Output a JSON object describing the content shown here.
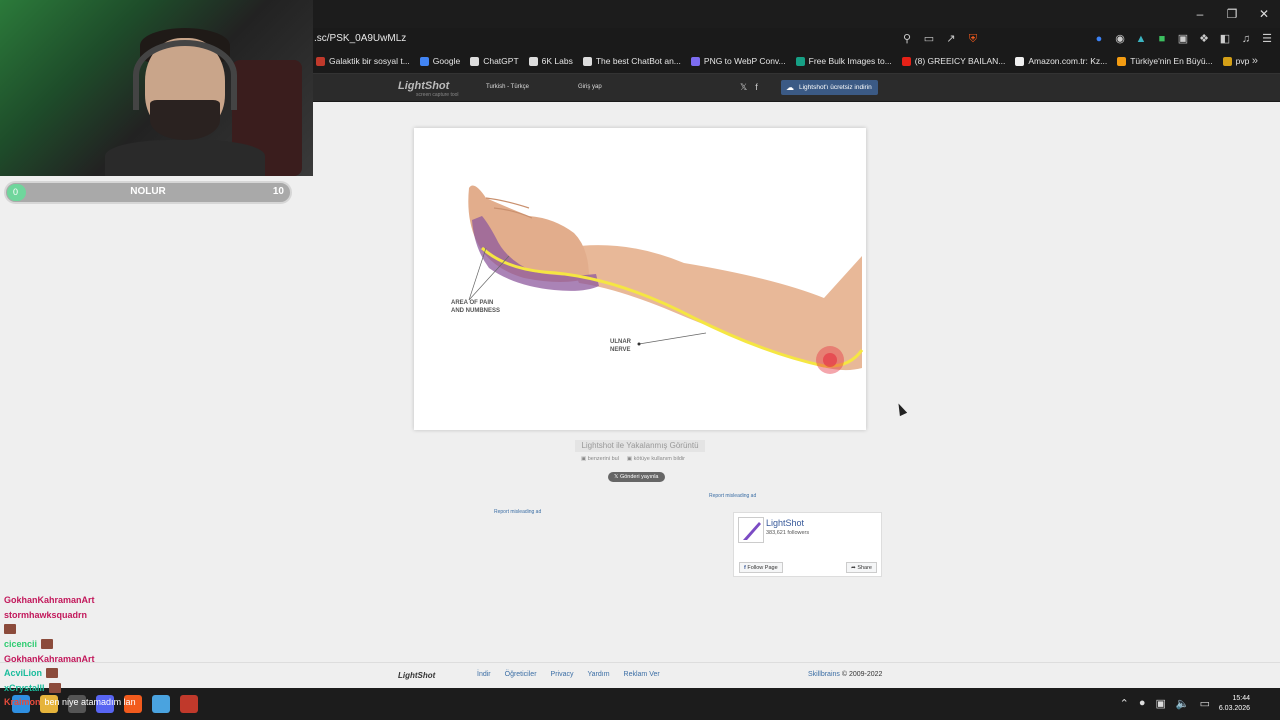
{
  "browser": {
    "url": ".sc/PSK_0A9UwMLz",
    "bookmarks": [
      {
        "label": "Galaktik bir sosyal t...",
        "color": "#c0392b"
      },
      {
        "label": "Google",
        "color": "#4285f4"
      },
      {
        "label": "ChatGPT",
        "color": "#dddddd"
      },
      {
        "label": "6K Labs",
        "color": "#dddddd"
      },
      {
        "label": "The best ChatBot an...",
        "color": "#dddddd"
      },
      {
        "label": "PNG to WebP Conv...",
        "color": "#7c6cf0"
      },
      {
        "label": "Free Bulk Images to...",
        "color": "#16a085"
      },
      {
        "label": "(8) GREEICY BAILAN...",
        "color": "#e62117"
      },
      {
        "label": "Amazon.com.tr: Kz...",
        "color": "#f0f0f0"
      },
      {
        "label": "Türkiye'nin En Büyü...",
        "color": "#f39c12"
      },
      {
        "label": "pvp",
        "color": "#d4a017"
      }
    ]
  },
  "lightshot": {
    "logo": "LightShot",
    "logo_sub": "screen capture tool",
    "language": "Turkish - Türkçe",
    "login": "Giriş yap",
    "download_button": "Lightshot'ı ücretsiz indirin",
    "image_labels": {
      "pain_area_line1": "AREA OF PAIN",
      "pain_area_line2": "AND NUMBNESS",
      "nerve_line1": "ULNAR",
      "nerve_line2": "NERVE"
    },
    "caption": "Lightshot ile Yakalanmış Görüntü",
    "find_similar": "benzerini bul",
    "report_abuse": "kötüye kullanım bildir",
    "tweet_button": "Gönderi yayınla",
    "ad_link": "Report misleading ad",
    "facebook": {
      "page_name": "LightShot",
      "followers": "383,621 followers",
      "follow": "Follow Page",
      "share": "Share"
    },
    "footer": {
      "logo": "LightShot",
      "links": [
        "İndir",
        "Öğreticiler",
        "Privacy",
        "Yardım",
        "Reklam Ver"
      ],
      "brand": "Skillbrains",
      "copyright": "© 2009-2022"
    }
  },
  "overlay": {
    "poll": {
      "left_count": "0",
      "label": "NOLUR",
      "right_count": "10"
    },
    "chat": [
      {
        "user": "GokhanKahramanArt",
        "color": "#c2185b",
        "emote": false
      },
      {
        "user": "stormhawksquadrn",
        "color": "#c2185b",
        "emote": false
      },
      {
        "user": "",
        "color": "#c2185b",
        "emote": true
      },
      {
        "user": "cicencii",
        "color": "#2ecc71",
        "emote": true
      },
      {
        "user": "GokhanKahramanArt",
        "color": "#c2185b",
        "emote": false
      },
      {
        "user": "AcviLion",
        "color": "#1abc9c",
        "emote": true
      },
      {
        "user": "xCrystalll",
        "color": "#1abc9c",
        "emote": true
      },
      {
        "user": "Kraimon",
        "color": "#e74c3c",
        "emote": false,
        "message": "ben niye atamadım lan"
      }
    ]
  },
  "taskbar": {
    "time": "15:44",
    "date": "6.03.2026"
  },
  "colors": {
    "accent_blue": "#3b5a85",
    "nerve_yellow": "#f5e642",
    "pain_purple": "#8e5a9e",
    "skin": "#e8b898"
  }
}
